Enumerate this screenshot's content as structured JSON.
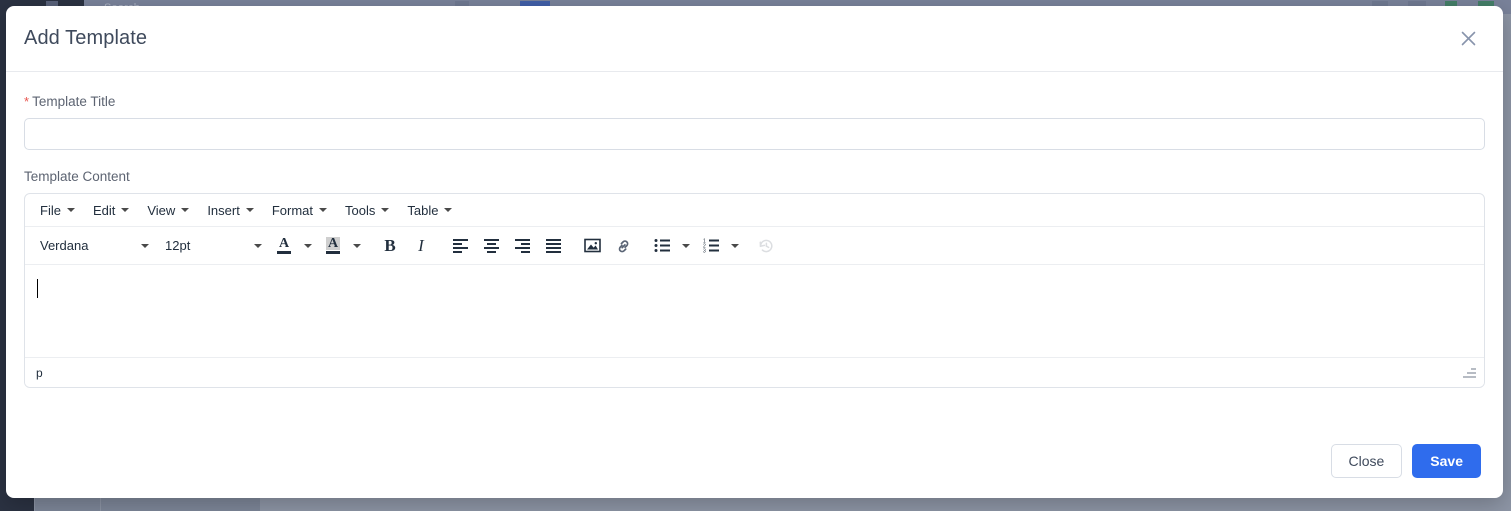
{
  "background": {
    "search_placeholder": "Search"
  },
  "modal": {
    "title": "Add Template",
    "close_icon": "close-icon",
    "fields": {
      "template_title": {
        "label": "Template Title",
        "required_marker": "*",
        "value": "",
        "placeholder": ""
      },
      "template_content": {
        "label": "Template Content"
      }
    },
    "editor": {
      "menubar": [
        {
          "label": "File"
        },
        {
          "label": "Edit"
        },
        {
          "label": "View"
        },
        {
          "label": "Insert"
        },
        {
          "label": "Format"
        },
        {
          "label": "Tools"
        },
        {
          "label": "Table"
        }
      ],
      "toolbar": {
        "font_family": "Verdana",
        "font_size": "12pt",
        "buttons": [
          {
            "name": "text-color-icon",
            "label": "A"
          },
          {
            "name": "background-color-icon",
            "label": "A"
          },
          {
            "name": "bold-icon",
            "label": "B"
          },
          {
            "name": "italic-icon",
            "label": "I"
          },
          {
            "name": "align-left-icon",
            "label": ""
          },
          {
            "name": "align-center-icon",
            "label": ""
          },
          {
            "name": "align-right-icon",
            "label": ""
          },
          {
            "name": "align-justify-icon",
            "label": ""
          },
          {
            "name": "image-icon",
            "label": ""
          },
          {
            "name": "link-icon",
            "label": ""
          },
          {
            "name": "bullet-list-icon",
            "label": ""
          },
          {
            "name": "numbered-list-icon",
            "label": ""
          },
          {
            "name": "restore-draft-icon",
            "label": ""
          }
        ]
      },
      "content": "",
      "status_path": "p"
    },
    "footer": {
      "close_label": "Close",
      "save_label": "Save"
    }
  },
  "colors": {
    "accent": "#2f6ced",
    "required": "#e8554f",
    "title_text": "#3f4a5c",
    "label_text": "#5d6472",
    "border": "#d8dde5"
  }
}
